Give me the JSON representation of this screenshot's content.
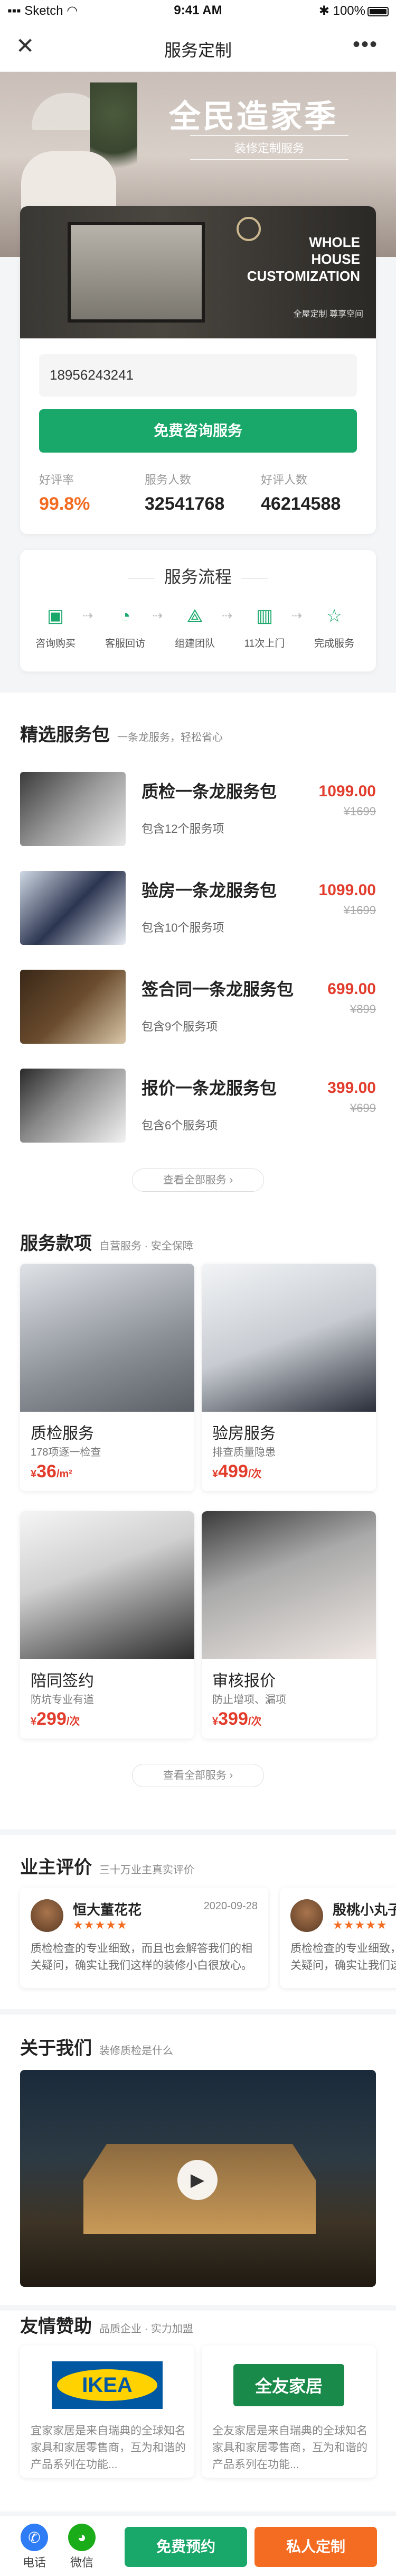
{
  "status_bar": {
    "carrier": "Sketch",
    "time": "9:41 AM",
    "battery": "100%"
  },
  "nav": {
    "title": "服务定制"
  },
  "hero": {
    "title": "全民造家季",
    "subtitle": "装修定制服务"
  },
  "customize": {
    "banner_title_1": "WHOLE",
    "banner_title_2": "HOUSE CUSTOMIZATION",
    "banner_tag": "全屋定制 尊享空间",
    "phone_value": "18956243241",
    "free_button": "免费咨询服务",
    "stats": [
      {
        "label": "好评率",
        "value": "99.8%"
      },
      {
        "label": "服务人数",
        "value": "32541768"
      },
      {
        "label": "好评人数",
        "value": "46214588"
      }
    ]
  },
  "process": {
    "title": "服务流程",
    "steps": [
      {
        "label": "咨询购买",
        "icon": "wallet-icon"
      },
      {
        "label": "客服回访",
        "icon": "chat-icon"
      },
      {
        "label": "组建团队",
        "icon": "team-icon"
      },
      {
        "label": "11次上门",
        "icon": "building-icon"
      },
      {
        "label": "完成服务",
        "icon": "star-icon"
      }
    ]
  },
  "packages": {
    "title": "精选服务包",
    "subtitle": "一条龙服务，轻松省心",
    "items": [
      {
        "name": "质检一条龙服务包",
        "count": "包含12个服务项",
        "price": "1099.00",
        "old": "¥1699"
      },
      {
        "name": "验房一条龙服务包",
        "count": "包含10个服务项",
        "price": "1099.00",
        "old": "¥1699"
      },
      {
        "name": "签合同一条龙服务包",
        "count": "包含9个服务项",
        "price": "699.00",
        "old": "¥899"
      },
      {
        "name": "报价一条龙服务包",
        "count": "包含6个服务项",
        "price": "399.00",
        "old": "¥699"
      }
    ],
    "view_all": "查看全部服务"
  },
  "services": {
    "title": "服务款项",
    "subtitle": "自营服务 · 安全保障",
    "items": [
      {
        "name": "质检服务",
        "desc": "178项逐一检查",
        "currency": "¥",
        "price": "36",
        "unit": "/m²"
      },
      {
        "name": "验房服务",
        "desc": "排查质量隐患",
        "currency": "¥",
        "price": "499",
        "unit": "/次"
      },
      {
        "name": "陪同签约",
        "desc": "防坑专业有道",
        "currency": "¥",
        "price": "299",
        "unit": "/次"
      },
      {
        "name": "审核报价",
        "desc": "防止增项、漏项",
        "currency": "¥",
        "price": "399",
        "unit": "/次"
      }
    ],
    "view_all": "查看全部服务"
  },
  "reviews": {
    "title": "业主评价",
    "subtitle": "三十万业主真实评价",
    "items": [
      {
        "name": "恒大董花花",
        "stars": "★★★★★",
        "date": "2020-09-28",
        "text": "质检检查的专业细致，而且也会解答我们的相关疑问，确实让我们这样的装修小白很放心。"
      },
      {
        "name": "殷桃小丸子",
        "stars": "★★★★★",
        "date": "",
        "text": "质检检查的专业细致，而且也会解答我们的相关疑问，确实让我们这样的装修小白很放心。"
      }
    ]
  },
  "about": {
    "title": "关于我们",
    "subtitle": "装修质检是什么"
  },
  "sponsors": {
    "title": "友情赞助",
    "subtitle": "品质企业 · 实力加盟",
    "items": [
      {
        "logo": "IKEA",
        "text": "宜家家居是来自瑞典的全球知名家具和家居零售商，互为和谐的产品系列在功能..."
      },
      {
        "logo": "全友家居",
        "text": "全友家居是来自瑞典的全球知名家具和家居零售商，互为和谐的产品系列在功能..."
      }
    ]
  },
  "bottom_bar": {
    "phone": "电话",
    "wechat": "微信",
    "book": "免费预约",
    "custom": "私人定制"
  },
  "colors": {
    "green": "#1aa86a",
    "orange": "#f36c21",
    "red": "#e23c2c"
  }
}
